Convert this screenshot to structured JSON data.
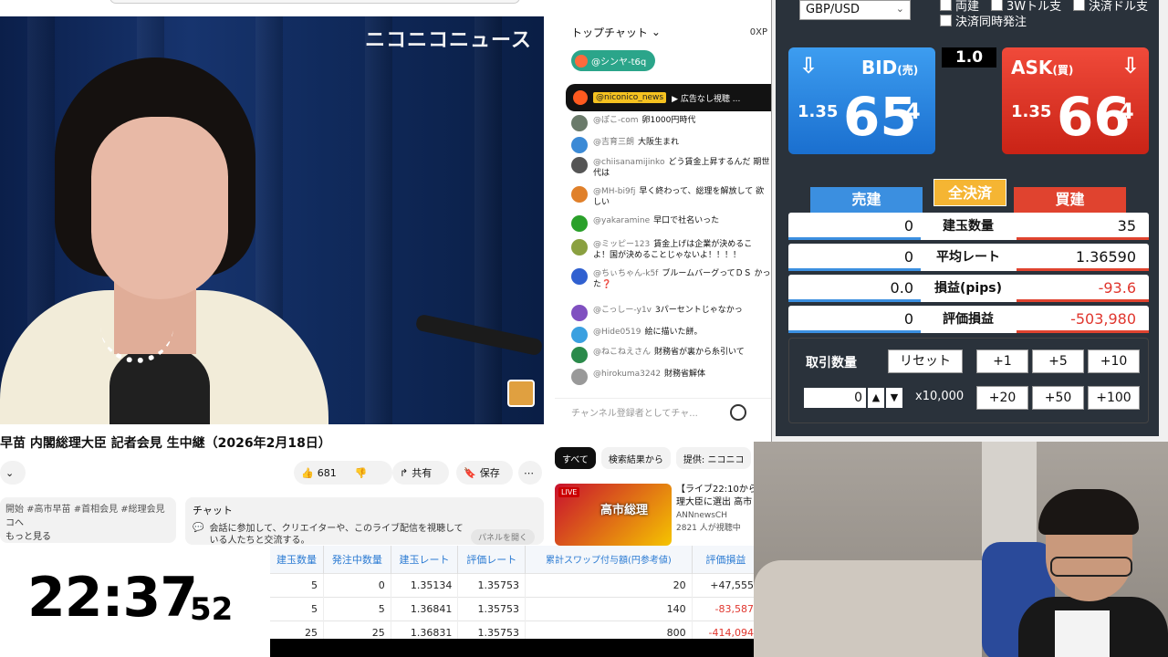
{
  "video": {
    "watermark": "ニコニコニュース",
    "title": "早苗 内閣総理大臣 記者会見 生中継（2026年2月18日）",
    "likes": "681",
    "share_label": "共有",
    "save_label": "保存",
    "description_line1": "開始 #高市早苗 #首相会見 #総理会見",
    "description_line2": "コへ",
    "description_more": "もっと見る"
  },
  "chat_promo": {
    "heading": "チャット",
    "body": "会話に参加して、クリエイターや、このライブ配信を視聴している人たちと交流する。",
    "open_panel": "パネルを開く"
  },
  "live_chat": {
    "mode": "トップチャット",
    "xp": "0XP",
    "user_pill": "@シンヤ-t6q",
    "pinned_user": "@niconico_news",
    "pinned_text": "▶ 広告なし視聴 ...",
    "messages": [
      {
        "user": "@ぽこ-com",
        "text": "卵1000円時代",
        "color": "#6a7a6a"
      },
      {
        "user": "@吉育三朗",
        "text": "大阪生まれ",
        "color": "#3b8ad6"
      },
      {
        "user": "@chiisanamijinko",
        "text": "どう賃金上昇するんだ 期世代は",
        "color": "#555555"
      },
      {
        "user": "@MH-bi9fj",
        "text": "早く終わって、総理を解放して 欲しい",
        "color": "#e0802a"
      },
      {
        "user": "@yakaramine",
        "text": "早口で社名いった",
        "color": "#2aa02a"
      },
      {
        "user": "@ミッピー123",
        "text": "賃金上げは企業が決めるこ よ！国が決めることじゃないよ！！！！",
        "color": "#8aa040"
      },
      {
        "user": "@ちぃちゃん-k5f",
        "text": "ブルームバーグってＤＳ かった❓",
        "color": "#3060d0"
      },
      {
        "user": "@こっしー-y1v",
        "text": "3パーセントじゃなかっ",
        "color": "#8050c0"
      },
      {
        "user": "@Hide0519",
        "text": "絵に描いた餅。",
        "color": "#3aa0e0"
      },
      {
        "user": "@ねこねえさん",
        "text": "財務省が裏から糸引いて",
        "color": "#2a8a4a"
      },
      {
        "user": "@hirokuma3242",
        "text": "財務省解体",
        "color": "#999999"
      }
    ],
    "input_placeholder": "チャンネル登録者としてチャ..."
  },
  "related": {
    "tabs": [
      "すべて",
      "検索結果から",
      "提供: ニコニコ"
    ],
    "thumb_live": "LIVE",
    "thumb_title": "高市総理",
    "title": "【ライブ22:10から】理大臣に選出 高市",
    "channel": "ANNnewsCH",
    "views": "2821 人が視聴中"
  },
  "clock": {
    "hm": "22:37",
    "sec": "52"
  },
  "positions": {
    "headers": [
      "建玉数量",
      "発注中数量",
      "建玉レート",
      "評価レート",
      "累計スワップ付与額(円参考値)",
      "評価損益"
    ],
    "rows": [
      [
        "5",
        "0",
        "1.35134",
        "1.35753",
        "20",
        "+47,555"
      ],
      [
        "5",
        "5",
        "1.36841",
        "1.35753",
        "140",
        "-83,587"
      ],
      [
        "25",
        "25",
        "1.36831",
        "1.35753",
        "800",
        "-414,094"
      ]
    ]
  },
  "trade": {
    "pair": "GBP/USD",
    "checks": [
      "両建",
      "3Wトル支",
      "決済同時発注",
      "決済ドル支"
    ],
    "bid_label": "BID",
    "bid_sub": "(売)",
    "bid_small": "1.35",
    "bid_big": "65",
    "bid_sup": "4",
    "ask_label": "ASK",
    "ask_sub": "(買)",
    "ask_small": "1.35",
    "ask_big": "66",
    "ask_sup": "4",
    "spread": "1.0",
    "sell_header": "売建",
    "close_all": "全決済",
    "buy_header": "買建",
    "rows": [
      {
        "left": "0",
        "label": "建玉数量",
        "right": "35",
        "neg": false
      },
      {
        "left": "0",
        "label": "平均レート",
        "right": "1.36590",
        "neg": false
      },
      {
        "left": "0.0",
        "label": "損益(pips)",
        "right": "-93.6",
        "neg": true
      },
      {
        "left": "0",
        "label": "評価損益",
        "right": "-503,980",
        "neg": true
      }
    ],
    "qty_label": "取引数量",
    "reset": "リセット",
    "qty_buttons_row1": [
      "+1",
      "+5",
      "+10"
    ],
    "qty_buttons_row2": [
      "+20",
      "+50",
      "+100"
    ],
    "qty_value": "0",
    "multiplier": "x10,000"
  }
}
